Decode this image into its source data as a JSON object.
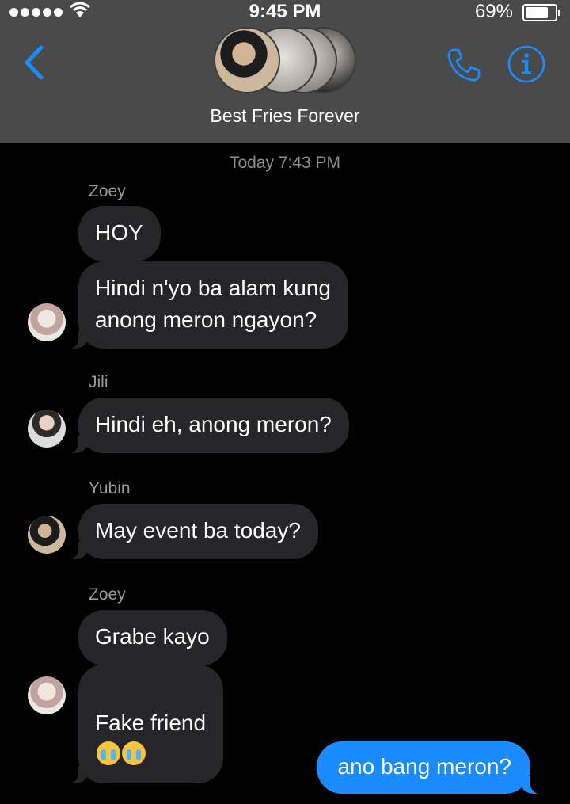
{
  "status_bar": {
    "time": "9:45 PM",
    "battery": "69%"
  },
  "header": {
    "title": "Best Fries Forever"
  },
  "timestamp": "Today 7:43 PM",
  "messages": [
    {
      "sender": "Zoey",
      "text": "HOY"
    },
    {
      "text": "Hindi n'yo ba alam kung\nanong meron ngayon?"
    },
    {
      "sender": "Jili",
      "text": "Hindi eh, anong meron?"
    },
    {
      "sender": "Yubin",
      "text": "May event ba today?"
    },
    {
      "sender": "Zoey",
      "text": "Grabe kayo"
    },
    {
      "text": "Fake friend"
    },
    {
      "text": "ano bang meron?",
      "outgoing": true
    }
  ],
  "icons": {
    "back": "chevron-left-icon",
    "call": "phone-icon",
    "info": "info-icon",
    "emoji": "loudly-crying-face-emoji"
  },
  "colors": {
    "accent": "#1a8cff",
    "incoming_bubble": "#262628",
    "header": "#4a4a4a"
  }
}
